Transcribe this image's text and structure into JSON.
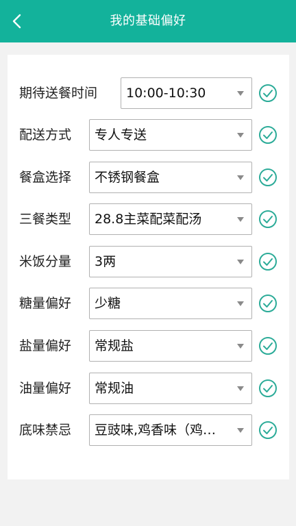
{
  "header": {
    "title": "我的基础偏好",
    "back_icon": "chevron-left-icon"
  },
  "colors": {
    "brand": "#13b29b",
    "check": "#2bab98"
  },
  "preferences": [
    {
      "label": "期待送餐时间",
      "value": "10:00-10:30"
    },
    {
      "label": "配送方式",
      "value": "专人专送"
    },
    {
      "label": "餐盒选择",
      "value": "不锈钢餐盒"
    },
    {
      "label": "三餐类型",
      "value": "28.8主菜配菜配汤"
    },
    {
      "label": "米饭分量",
      "value": "3两"
    },
    {
      "label": "糖量偏好",
      "value": "少糖"
    },
    {
      "label": "盐量偏好",
      "value": "常规盐"
    },
    {
      "label": "油量偏好",
      "value": "常规油"
    },
    {
      "label": "底味禁忌",
      "value": "豆豉味,鸡香味（鸡…"
    }
  ]
}
